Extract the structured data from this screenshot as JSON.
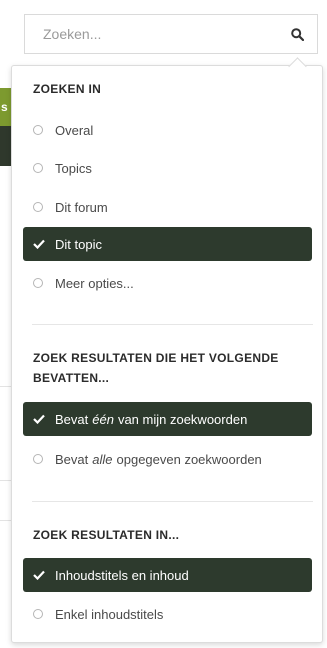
{
  "background": {
    "tab_fragment": "s"
  },
  "search": {
    "placeholder": "Zoeken..."
  },
  "dropdown": {
    "section_search_in": {
      "heading": "ZOEKEN IN",
      "options": [
        {
          "label": "Overal",
          "selected": false
        },
        {
          "label": "Topics",
          "selected": false
        },
        {
          "label": "Dit forum",
          "selected": false
        },
        {
          "label": "Dit topic",
          "selected": true
        },
        {
          "label": "Meer opties...",
          "selected": false
        }
      ]
    },
    "section_contains": {
      "heading_line1": "ZOEK RESULTATEN DIE HET VOLGENDE",
      "heading_line2": "BEVATTEN...",
      "options": [
        {
          "before": "Bevat",
          "emphasis": "één",
          "after": "van mijn zoekwoorden",
          "selected": true
        },
        {
          "before": "Bevat",
          "emphasis": "alle",
          "after": "opgegeven zoekwoorden",
          "selected": false
        }
      ]
    },
    "section_results_in": {
      "heading": "ZOEK RESULTATEN IN...",
      "options": [
        {
          "label": "Inhoudstitels en inhoud",
          "selected": true
        },
        {
          "label": "Enkel inhoudstitels",
          "selected": false
        }
      ]
    }
  },
  "colors": {
    "selected_bg": "#2d3a2d",
    "brand_green": "#7d9a2f"
  }
}
